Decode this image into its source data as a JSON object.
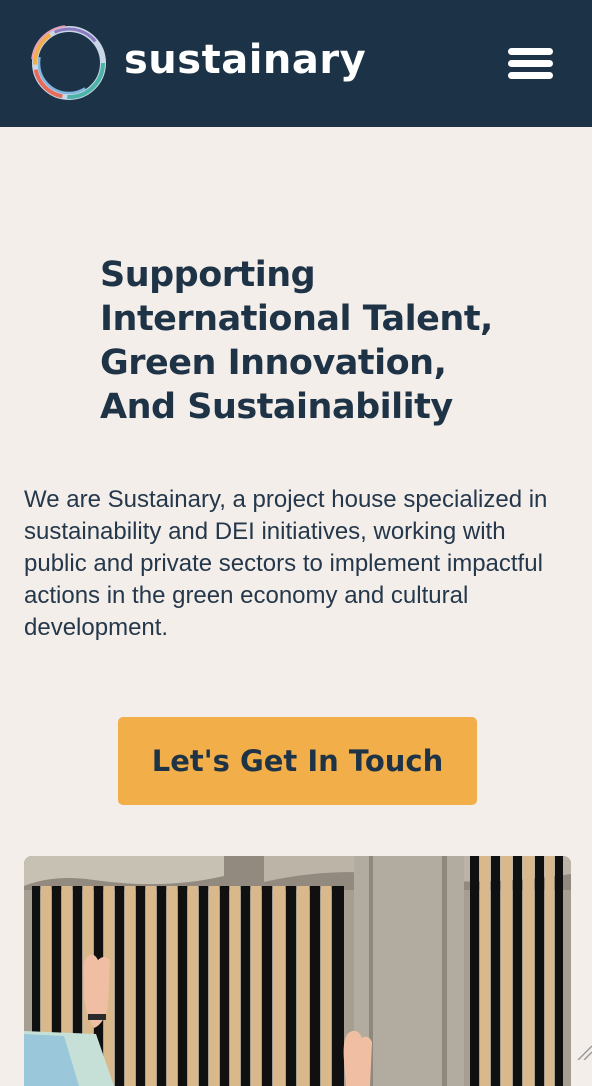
{
  "header": {
    "brand_name": "sustainary",
    "logo_icon": "multicolor-ring-logo",
    "menu_icon": "hamburger-menu-icon"
  },
  "hero": {
    "headline_lines": [
      "Supporting",
      "International Talent,",
      "Green Innovation,",
      "And Sustainability"
    ],
    "intro": "We are Sustainary, a project house specialized in sustainability and DEI initiatives, working with public and private sectors to implement impactful actions in the green economy and cultural development.",
    "cta_label": "Let's Get In Touch"
  },
  "colors": {
    "header_bg": "#1c3347",
    "page_bg": "#f3eeea",
    "text_dark": "#1f3346",
    "cta_bg": "#f2ae49"
  }
}
